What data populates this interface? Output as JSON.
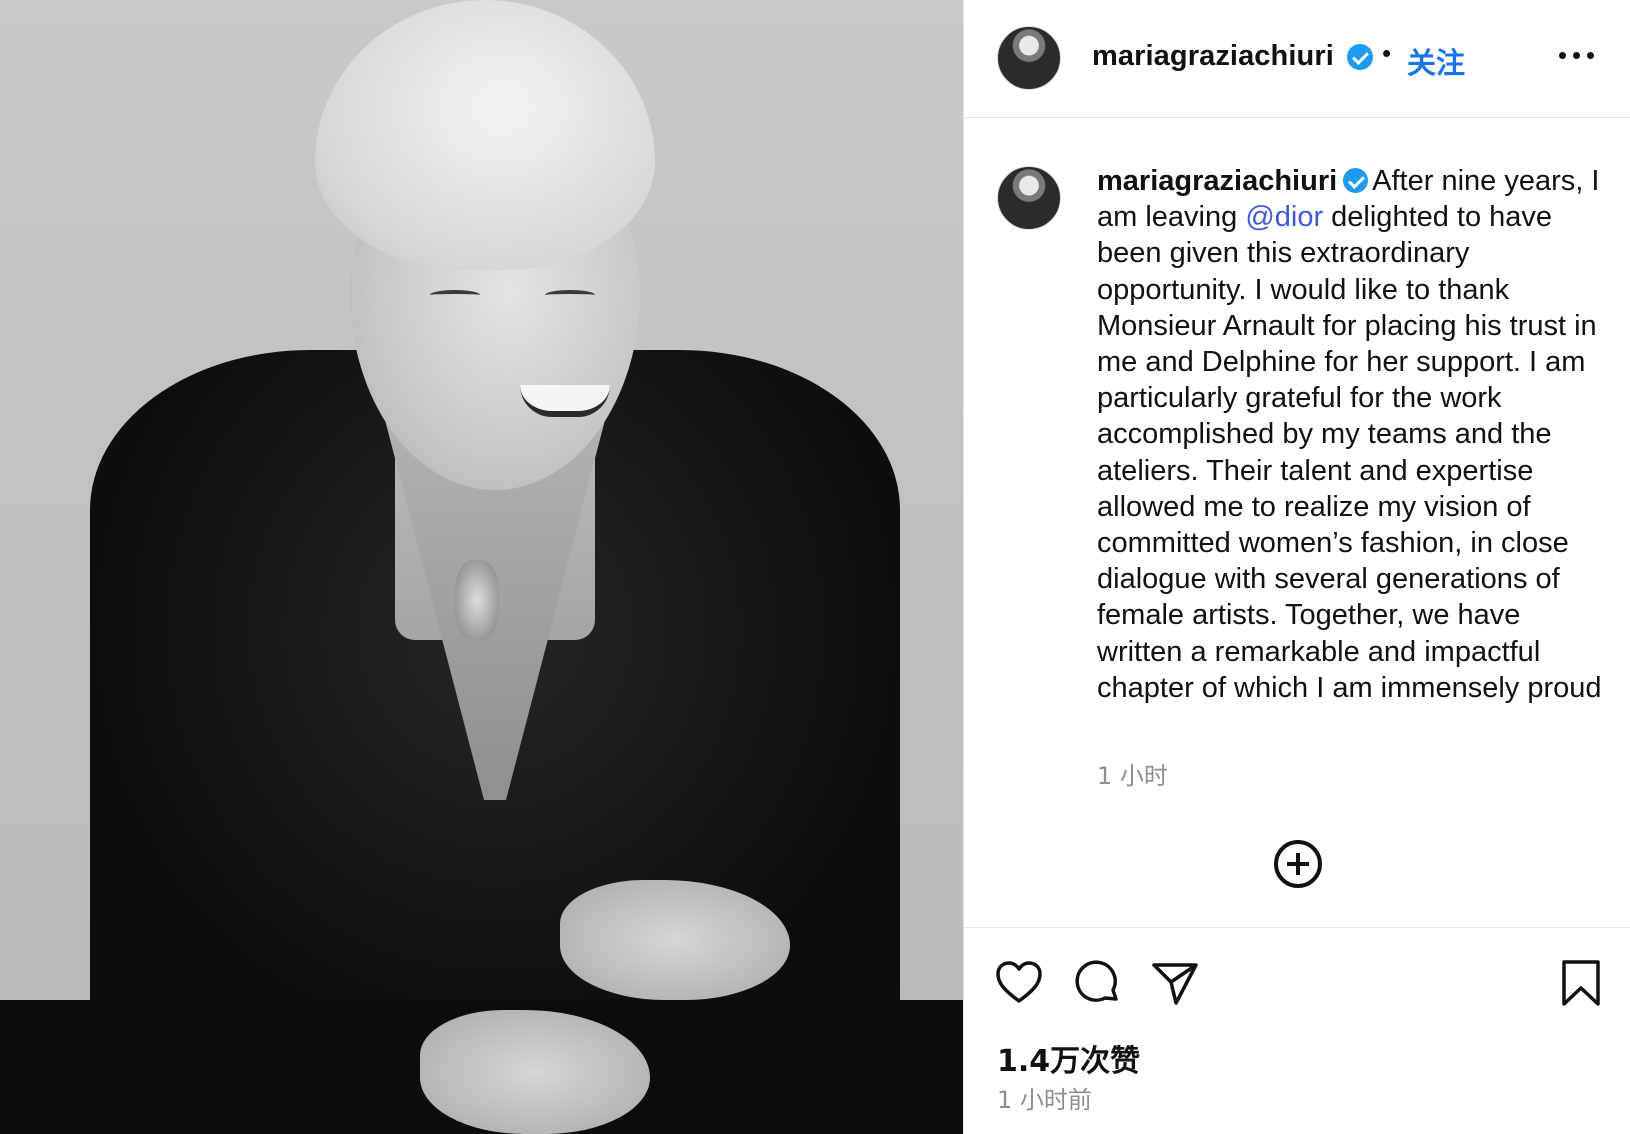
{
  "post": {
    "image_alt": "Black and white portrait photograph"
  },
  "header": {
    "username": "mariagraziachiuri",
    "separator": "•",
    "follow_label": "关注"
  },
  "caption": {
    "username": "mariagraziachiuri",
    "text_before_mention": "After nine years, I am leaving ",
    "mention": "@dior",
    "text_after_mention": " delighted to have been given this extraordinary opportunity. I would like to thank Monsieur Arnault for placing his trust in me and Delphine for her support. I am particularly grateful for the work accomplished by my teams and the ateliers. Their talent and expertise allowed me to realize my vision of committed women’s fashion, in close dialogue with several generations of female artists. Together, we have written a remarkable and impactful chapter of which I am immensely proud",
    "time": "1 小时"
  },
  "actions": {
    "likes": "1.4万次赞",
    "posted_time": "1 小时前"
  },
  "icons": [
    "verified-badge-icon",
    "more-options-icon",
    "add-comment-icon",
    "heart-icon",
    "comment-icon",
    "share-icon",
    "bookmark-icon"
  ],
  "colors": {
    "verified": "#1d9bf0",
    "follow": "#1a73e8",
    "mention": "#3f5bd6",
    "muted": "#8e8e8e"
  }
}
